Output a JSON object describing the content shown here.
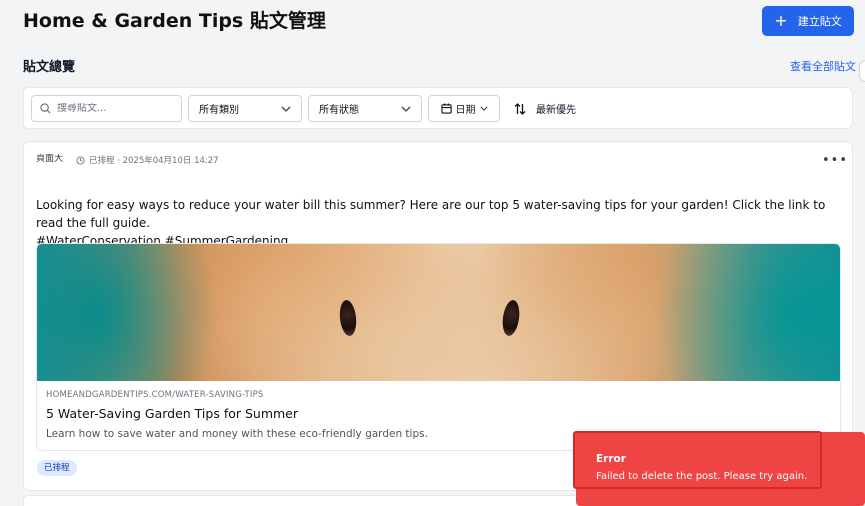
{
  "header": {
    "title": "Home & Garden Tips 貼文管理",
    "create_label": "建立貼文"
  },
  "overview": {
    "title": "貼文總覽",
    "view_all": "查看全部貼文"
  },
  "filters": {
    "search_placeholder": "搜尋貼文...",
    "type_selected": "所有類別",
    "status_selected": "所有狀態",
    "date_label": "日期",
    "sort_label": "最新優先"
  },
  "post": {
    "avatar_alt": "頁面大",
    "status_meta": "已排程 · 2025年04月10日 14:27",
    "text_line1": "Looking for easy ways to reduce your water bill this summer? Here are our top 5 water-saving tips for your garden! Click the link to read the full guide.",
    "text_line2": "#WaterConservation #SummerGardening",
    "link_domain": "HOMEANDGARDENTIPS.COM/WATER-SAVING-TIPS",
    "link_title": "5 Water-Saving Garden Tips for Summer",
    "link_description": "Learn how to save water and money with these eco-friendly garden tips.",
    "status_badge": "已排程"
  },
  "toast": {
    "title": "Error",
    "message": "Failed to delete the post. Please try again."
  },
  "colors": {
    "accent": "#2563eb",
    "error": "#ef4444",
    "badge_bg": "#dbeafe"
  }
}
